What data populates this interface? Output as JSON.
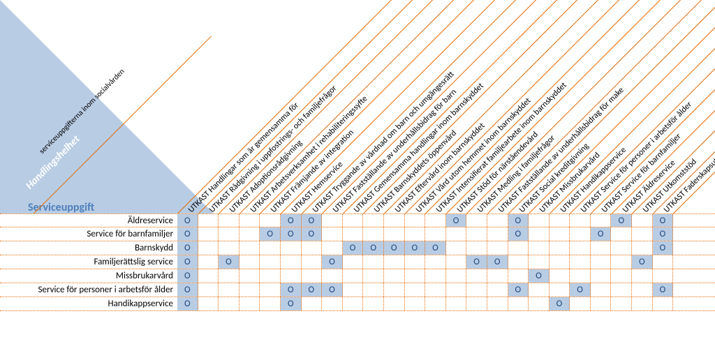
{
  "header": {
    "handlingshelhet": "Handlingshelhet",
    "serviceuppgift": "Serviceuppgift",
    "inner_label": "serviceuppgifterna inom socialvården"
  },
  "columns": [
    "UTKAST Handlingar som är gemensamma för",
    "UTKAST Rådgivning i uppfostrings- och familjefrågor",
    "UTKAST Adoptionsrådgivning",
    "UTKAST Arbetsverksamhet i rehabiliteringssyfte",
    "UTKAST Främjande av integration",
    "UTKAST Hemservice",
    "UTKAST Tryggande av vårdnad om barn och umgängesrätt",
    "UTKAST Fastställande av underhållsbidrag för barn",
    "UTKAST Gemensamma handlingar inom barnskyddet",
    "UTKAST Barnskyddets öppenvård",
    "UTKAST Eftervård inom barnskyddet",
    "UTKAST Vård utom hemmet inom barnskyddet",
    "UTKAST Intensifierat familjearbete inom barnskyddet",
    "UTKAST Stöd för närståendevård",
    "UTKAST Medling i familjefrågor",
    "UTKAST Fastställande av underhållsbidrag för make",
    "UTKAST Social kreditgivning",
    "UTKAST Missbrukarvård",
    "UTKAST Handikappservice",
    "UTKAST Service för personer i arbetsför ålder",
    "UTKAST Service för barnfamiljer",
    "UTKAST Äldreservice",
    "UTKAST Utkomststöd",
    "UTKAST Faderskapsutredning"
  ],
  "rows": [
    {
      "label": "Äldreservice",
      "marks": [
        0,
        5,
        6,
        13,
        16,
        21,
        23
      ]
    },
    {
      "label": "Service för barnfamiljer",
      "marks": [
        0,
        4,
        5,
        6,
        16,
        20,
        23
      ]
    },
    {
      "label": "Barnskydd",
      "marks": [
        0,
        8,
        9,
        10,
        11,
        12,
        23
      ]
    },
    {
      "label": "Familjerättslig service",
      "marks": [
        0,
        2,
        7,
        14,
        15,
        22
      ]
    },
    {
      "label": "Missbrukarvård",
      "marks": [
        0,
        17
      ]
    },
    {
      "label": "Service för personer i arbetsför ålder",
      "marks": [
        0,
        5,
        6,
        7,
        16,
        19,
        23
      ]
    },
    {
      "label": "Handikappservice",
      "marks": [
        0,
        5,
        18
      ]
    }
  ],
  "mark_glyph": "O",
  "chart_data": {
    "type": "heatmap",
    "title": "",
    "xlabel": "Handlingshelhet",
    "ylabel": "Serviceuppgift",
    "x_categories": [
      "UTKAST Handlingar som är gemensamma för",
      "UTKAST Rådgivning i uppfostrings- och familjefrågor",
      "UTKAST Adoptionsrådgivning",
      "UTKAST Arbetsverksamhet i rehabiliteringssyfte",
      "UTKAST Främjande av integration",
      "UTKAST Hemservice",
      "UTKAST Tryggande av vårdnad om barn och umgängesrätt",
      "UTKAST Fastställande av underhållsbidrag för barn",
      "UTKAST Gemensamma handlingar inom barnskyddet",
      "UTKAST Barnskyddets öppenvård",
      "UTKAST Eftervård inom barnskyddet",
      "UTKAST Vård utom hemmet inom barnskyddet",
      "UTKAST Intensifierat familjearbete inom barnskyddet",
      "UTKAST Stöd för närståendevård",
      "UTKAST Medling i familjefrågor",
      "UTKAST Fastställande av underhållsbidrag för make",
      "UTKAST Social kreditgivning",
      "UTKAST Missbrukarvård",
      "UTKAST Handikappservice",
      "UTKAST Service för personer i arbetsför ålder",
      "UTKAST Service för barnfamiljer",
      "UTKAST Äldreservice",
      "UTKAST Utkomststöd",
      "UTKAST Faderskapsutredning"
    ],
    "y_categories": [
      "Äldreservice",
      "Service för barnfamiljer",
      "Barnskydd",
      "Familjerättslig service",
      "Missbrukarvård",
      "Service för personer i arbetsför ålder",
      "Handikappservice"
    ],
    "series": [
      {
        "name": "Äldreservice",
        "values": [
          1,
          0,
          0,
          0,
          0,
          1,
          1,
          0,
          0,
          0,
          0,
          0,
          0,
          1,
          0,
          0,
          1,
          0,
          0,
          0,
          0,
          1,
          0,
          1
        ]
      },
      {
        "name": "Service för barnfamiljer",
        "values": [
          1,
          0,
          0,
          0,
          1,
          1,
          1,
          0,
          0,
          0,
          0,
          0,
          0,
          0,
          0,
          0,
          1,
          0,
          0,
          0,
          1,
          0,
          0,
          1
        ]
      },
      {
        "name": "Barnskydd",
        "values": [
          1,
          0,
          0,
          0,
          0,
          0,
          0,
          0,
          1,
          1,
          1,
          1,
          1,
          0,
          0,
          0,
          0,
          0,
          0,
          0,
          0,
          0,
          0,
          1
        ]
      },
      {
        "name": "Familjerättslig service",
        "values": [
          1,
          0,
          1,
          0,
          0,
          0,
          0,
          1,
          0,
          0,
          0,
          0,
          0,
          0,
          1,
          1,
          0,
          0,
          0,
          0,
          0,
          0,
          1,
          0
        ]
      },
      {
        "name": "Missbrukarvård",
        "values": [
          1,
          0,
          0,
          0,
          0,
          0,
          0,
          0,
          0,
          0,
          0,
          0,
          0,
          0,
          0,
          0,
          0,
          1,
          0,
          0,
          0,
          0,
          0,
          0
        ]
      },
      {
        "name": "Service för personer i arbetsför ålder",
        "values": [
          1,
          0,
          0,
          0,
          0,
          1,
          1,
          1,
          0,
          0,
          0,
          0,
          0,
          0,
          0,
          0,
          1,
          0,
          0,
          1,
          0,
          0,
          0,
          1
        ]
      },
      {
        "name": "Handikappservice",
        "values": [
          1,
          0,
          0,
          0,
          0,
          1,
          0,
          0,
          0,
          0,
          0,
          0,
          0,
          0,
          0,
          0,
          0,
          0,
          1,
          0,
          0,
          0,
          0,
          0
        ]
      }
    ]
  }
}
